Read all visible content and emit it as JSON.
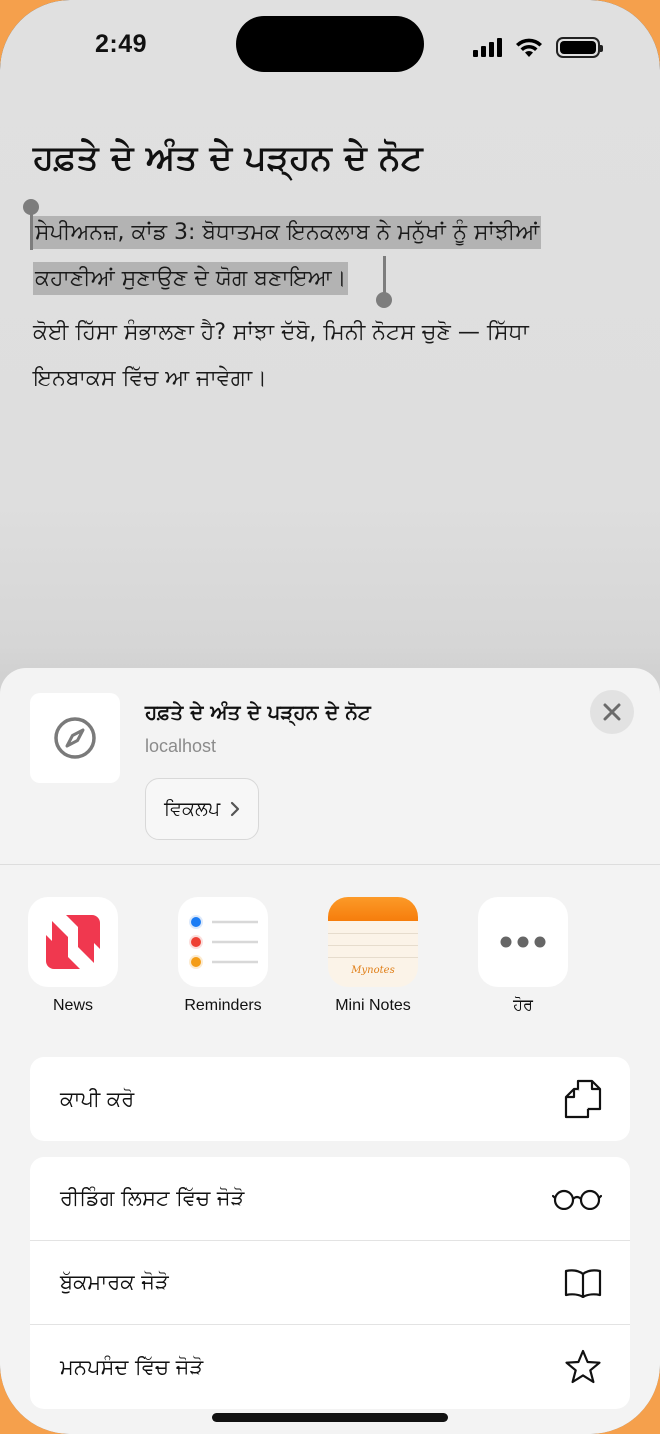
{
  "status_bar": {
    "time": "2:49"
  },
  "page": {
    "heading": "ਹਫ਼ਤੇ ਦੇ ਅੰਤ ਦੇ ਪੜ੍ਹਨ ਦੇ ਨੋਟ",
    "selected_line_1": "ਸੇਪੀਅਨਜ਼, ਕਾਂਡ 3: ਬੋਧਾਤਮਕ ਇਨਕਲਾਬ ਨੇ ਮਨੁੱਖਾਂ ਨੂੰ ਸਾਂਝੀਆਂ",
    "selected_line_2": "ਕਹਾਣੀਆਂ ਸੁਣਾਉਣ ਦੇ ਯੋਗ ਬਣਾਇਆ।",
    "body_line_1": "ਕੋਈ ਹਿੱਸਾ ਸੰਭਾਲਣਾ ਹੈ? ਸਾਂਝਾ ਦੱਬੋ, ਮਿਨੀ ਨੋਟਸ ਚੁਣੋ — ਸਿੱਧਾ",
    "body_line_2": "ਇਨਬਾਕਸ ਵਿੱਚ ਆ ਜਾਵੇਗਾ।"
  },
  "share_sheet": {
    "preview": {
      "title": "ਹਫ਼ਤੇ ਦੇ ਅੰਤ ਦੇ ਪੜ੍ਹਨ ਦੇ ਨੋਟ",
      "host": "localhost",
      "options_label": "ਵਿਕਲਪ",
      "icon": "compass-icon"
    },
    "apps": [
      {
        "label": "News",
        "icon": "news-icon"
      },
      {
        "label": "Reminders",
        "icon": "reminders-icon"
      },
      {
        "label": "Mini Notes",
        "icon": "mini-notes-icon",
        "logo_text": "Mynotes"
      },
      {
        "label": "ਹੋਰ",
        "icon": "more-icon"
      }
    ],
    "actions": {
      "copy": "ਕਾਪੀ ਕਰੋ",
      "reading_list": "ਰੀਡਿੰਗ ਲਿਸਟ ਵਿੱਚ ਜੋੜੋ",
      "bookmark": "ਬੁੱਕਮਾਰਕ ਜੋੜੋ",
      "favorites": "ਮਨਪਸੰਦ ਵਿੱਚ ਜੋੜੋ"
    }
  },
  "colors": {
    "background_accent": "#f5a04c",
    "news_red": "#f0384f",
    "notes_orange": "#fb8a12",
    "reminder_blue": "#1b7cf4",
    "reminder_red": "#ee4033",
    "reminder_orange": "#f49c16"
  }
}
